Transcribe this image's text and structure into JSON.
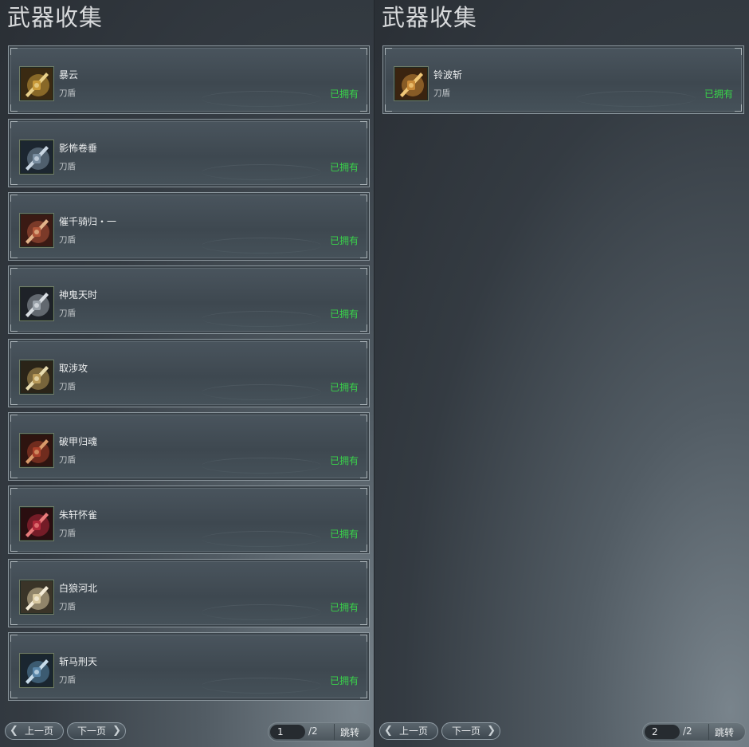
{
  "panels": [
    {
      "title": "武器收集",
      "items": [
        {
          "name": "暴云",
          "type": "刀盾",
          "status": "已拥有",
          "icon": "weapon-thumbnail-icon"
        },
        {
          "name": "影怖卷垂",
          "type": "刀盾",
          "status": "已拥有",
          "icon": "weapon-thumbnail-icon"
        },
        {
          "name": "催千骑归・一",
          "type": "刀盾",
          "status": "已拥有",
          "icon": "weapon-thumbnail-icon"
        },
        {
          "name": "神鬼天时",
          "type": "刀盾",
          "status": "已拥有",
          "icon": "weapon-thumbnail-icon"
        },
        {
          "name": "取涉攻",
          "type": "刀盾",
          "status": "已拥有",
          "icon": "weapon-thumbnail-icon"
        },
        {
          "name": "破甲归魂",
          "type": "刀盾",
          "status": "已拥有",
          "icon": "weapon-thumbnail-icon"
        },
        {
          "name": "朱轩怀雀",
          "type": "刀盾",
          "status": "已拥有",
          "icon": "weapon-thumbnail-icon"
        },
        {
          "name": "白狼河北",
          "type": "刀盾",
          "status": "已拥有",
          "icon": "weapon-thumbnail-icon"
        },
        {
          "name": "斩马刑天",
          "type": "刀盾",
          "status": "已拥有",
          "icon": "weapon-thumbnail-icon"
        }
      ],
      "pagination": {
        "prev_label": "上一页",
        "next_label": "下一页",
        "current_page": "1",
        "total_label": "/2",
        "jump_label": "跳转"
      }
    },
    {
      "title": "武器收集",
      "items": [
        {
          "name": "铃波斩",
          "type": "刀盾",
          "status": "已拥有",
          "icon": "weapon-thumbnail-icon"
        }
      ],
      "pagination": {
        "prev_label": "上一页",
        "next_label": "下一页",
        "current_page": "2",
        "total_label": "/2",
        "jump_label": "跳转"
      }
    }
  ],
  "colors": {
    "owned": "#39d24a",
    "title": "#d7d9db",
    "card_border": "#8b969d"
  },
  "icons": {
    "prev": "chevron-left-icon",
    "next": "chevron-right-icon"
  }
}
